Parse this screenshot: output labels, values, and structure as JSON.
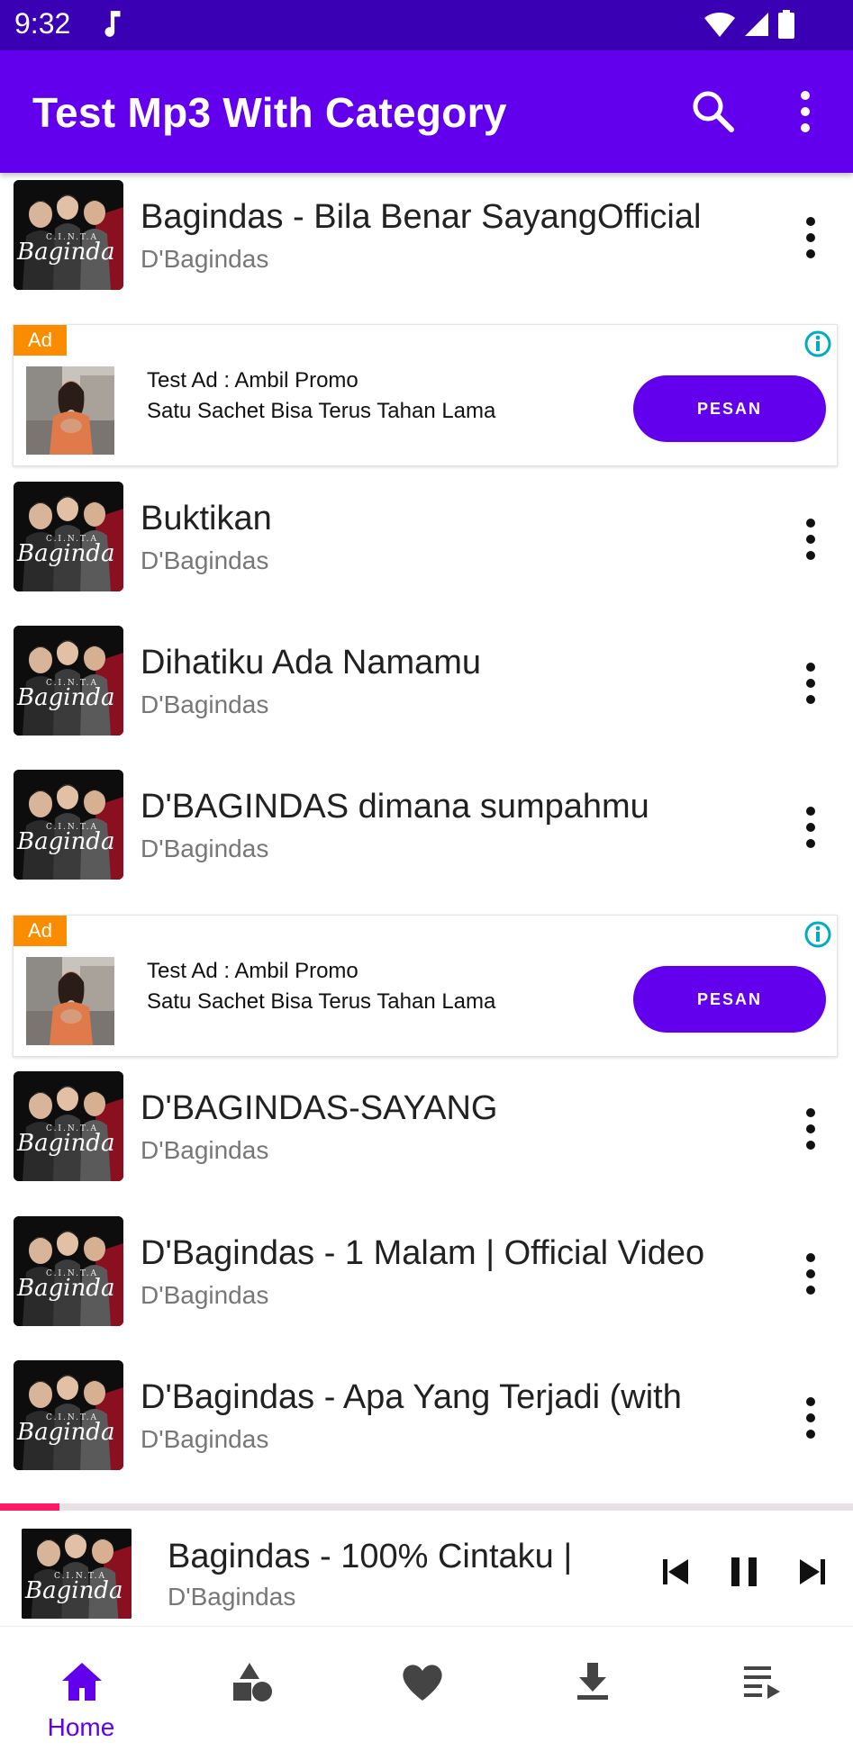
{
  "status_bar": {
    "time": "9:32"
  },
  "app_bar": {
    "title": "Test Mp3 With Category"
  },
  "list": [
    {
      "type": "song",
      "title": "Bagindas - Bila Benar SayangOfficial",
      "artist": "D'Bagindas"
    },
    {
      "type": "ad",
      "badge": "Ad",
      "line1": "Test Ad : Ambil Promo",
      "line2": "Satu Sachet Bisa Terus Tahan Lama",
      "cta": "PESAN"
    },
    {
      "type": "song",
      "title": "Buktikan",
      "artist": "D'Bagindas"
    },
    {
      "type": "song",
      "title": "Dihatiku Ada Namamu",
      "artist": "D'Bagindas"
    },
    {
      "type": "song",
      "title": "D'BAGINDAS dimana sumpahmu",
      "artist": "D'Bagindas"
    },
    {
      "type": "ad",
      "badge": "Ad",
      "line1": "Test Ad : Ambil Promo",
      "line2": "Satu Sachet Bisa Terus Tahan Lama",
      "cta": "PESAN"
    },
    {
      "type": "song",
      "title": "D'BAGINDAS-SAYANG",
      "artist": "D'Bagindas"
    },
    {
      "type": "song",
      "title": "D'Bagindas - 1 Malam | Official Video",
      "artist": "D'Bagindas"
    },
    {
      "type": "song",
      "title": "D'Bagindas - Apa Yang Terjadi (with",
      "artist": "D'Bagindas"
    }
  ],
  "album_art": {
    "text_small": "C.I.N.T.A",
    "text_logo": "Baginda"
  },
  "now_playing": {
    "title": "Bagindas - 100% Cintaku |",
    "artist": "D'Bagindas",
    "progress_fraction": 0.07,
    "controls": [
      "previous-icon",
      "pause-icon",
      "next-icon"
    ]
  },
  "bottom_nav": {
    "items": [
      {
        "icon": "home-icon",
        "label": "Home",
        "active": true
      },
      {
        "icon": "category-icon",
        "label": ""
      },
      {
        "icon": "heart-icon",
        "label": ""
      },
      {
        "icon": "download-icon",
        "label": ""
      },
      {
        "icon": "queue-icon",
        "label": ""
      }
    ]
  },
  "colors": {
    "primary": "#6200ee",
    "status_bar": "#3a00b3",
    "ad_badge": "#fb8c00",
    "progress": "#ff1a66",
    "info": "#00acc1"
  }
}
